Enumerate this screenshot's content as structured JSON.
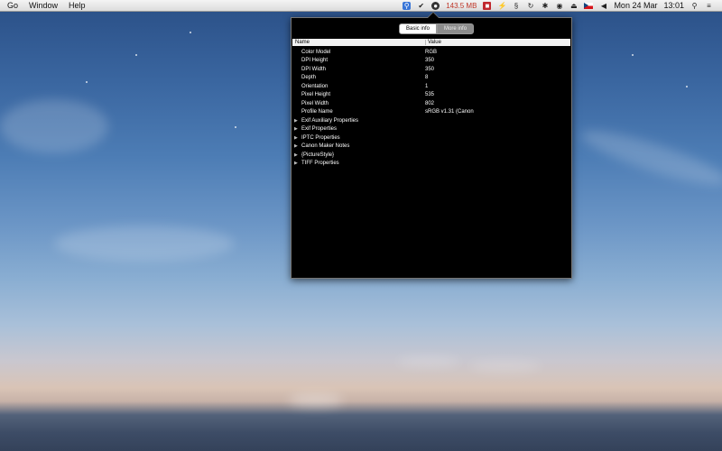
{
  "menubar": {
    "menus": [
      "Go",
      "Window",
      "Help"
    ],
    "memory": "143.5 MB",
    "date": "Mon 24 Mar",
    "time": "13:01"
  },
  "panel": {
    "tabs": {
      "basic": "Basic info",
      "more": "More info"
    },
    "columns": {
      "name": "Name",
      "value": "Value"
    },
    "properties": [
      {
        "name": "Color Model",
        "value": "RGB"
      },
      {
        "name": "DPI Height",
        "value": "350"
      },
      {
        "name": "DPI Width",
        "value": "350"
      },
      {
        "name": "Depth",
        "value": "8"
      },
      {
        "name": "Orientation",
        "value": "1"
      },
      {
        "name": "Pixel Height",
        "value": "535"
      },
      {
        "name": "Pixel Width",
        "value": "802"
      },
      {
        "name": "Profile Name",
        "value": "sRGB v1.31 (Canon"
      }
    ],
    "groups": [
      "Exif Auxiliary Properties",
      "Exif Properties",
      "IPTC Properties",
      "Canon Maker Notes",
      "{PictureStyle}",
      "TIFF Properties"
    ]
  }
}
